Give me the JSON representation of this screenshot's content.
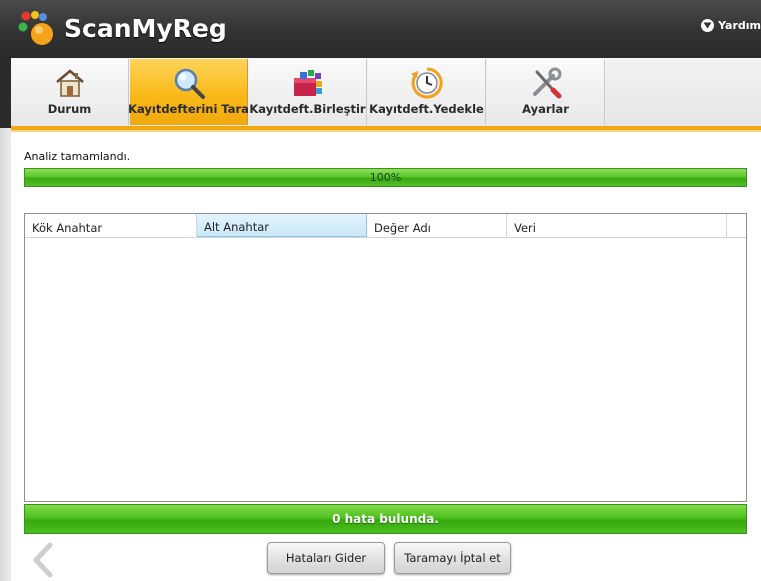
{
  "app": {
    "name": "ScanMyReg",
    "help_label": "Yardım"
  },
  "tabs": [
    {
      "label": "Durum",
      "icon": "house-icon",
      "active": false
    },
    {
      "label": "Kayıtdefterini Tara",
      "icon": "magnifier-icon",
      "active": true
    },
    {
      "label": "Kayıtdeft.Birleştir",
      "icon": "defrag-blocks-icon",
      "active": false
    },
    {
      "label": "Kayıtdeft.Yedekle",
      "icon": "clock-backup-icon",
      "active": false
    },
    {
      "label": "Ayarlar",
      "icon": "wrench-screwdriver-icon",
      "active": false
    }
  ],
  "scan": {
    "status_text": "Analiz tamamlandı.",
    "progress_label": "100%",
    "progress_value": 1.0
  },
  "results_table": {
    "columns": [
      "Kök Anahtar",
      "Alt Anahtar",
      "Değer Adı",
      "Veri"
    ],
    "selected_column": "Alt Anahtar",
    "rows": []
  },
  "result_summary": "0 hata bulunda.",
  "actions": {
    "fix_label": "Hataları Gider",
    "cancel_label": "Taramayı İptal et"
  },
  "colors": {
    "accent_orange": "#f4a80f",
    "progress_green": "#4fc01f",
    "header_dark": "#333333"
  }
}
